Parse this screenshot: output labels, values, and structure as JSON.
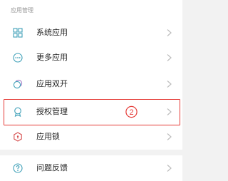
{
  "section": {
    "title": "应用管理"
  },
  "rows": [
    {
      "label": "系统应用",
      "icon": "grid-icon"
    },
    {
      "label": "更多应用",
      "icon": "more-dots-icon"
    },
    {
      "label": "应用双开",
      "icon": "dual-app-icon"
    },
    {
      "label": "授权管理",
      "icon": "permission-badge-icon"
    },
    {
      "label": "应用锁",
      "icon": "app-lock-icon"
    }
  ],
  "second_section": {
    "rows": [
      {
        "label": "问题反馈",
        "icon": "feedback-icon"
      }
    ]
  },
  "annotation": {
    "step_label": "2"
  },
  "colors": {
    "accent": "#3fa0b8",
    "highlight": "#e53935",
    "lock_icon": "#d64b4b",
    "text": "#222222",
    "muted": "#9a9a9a",
    "background": "#f2f2f2"
  }
}
